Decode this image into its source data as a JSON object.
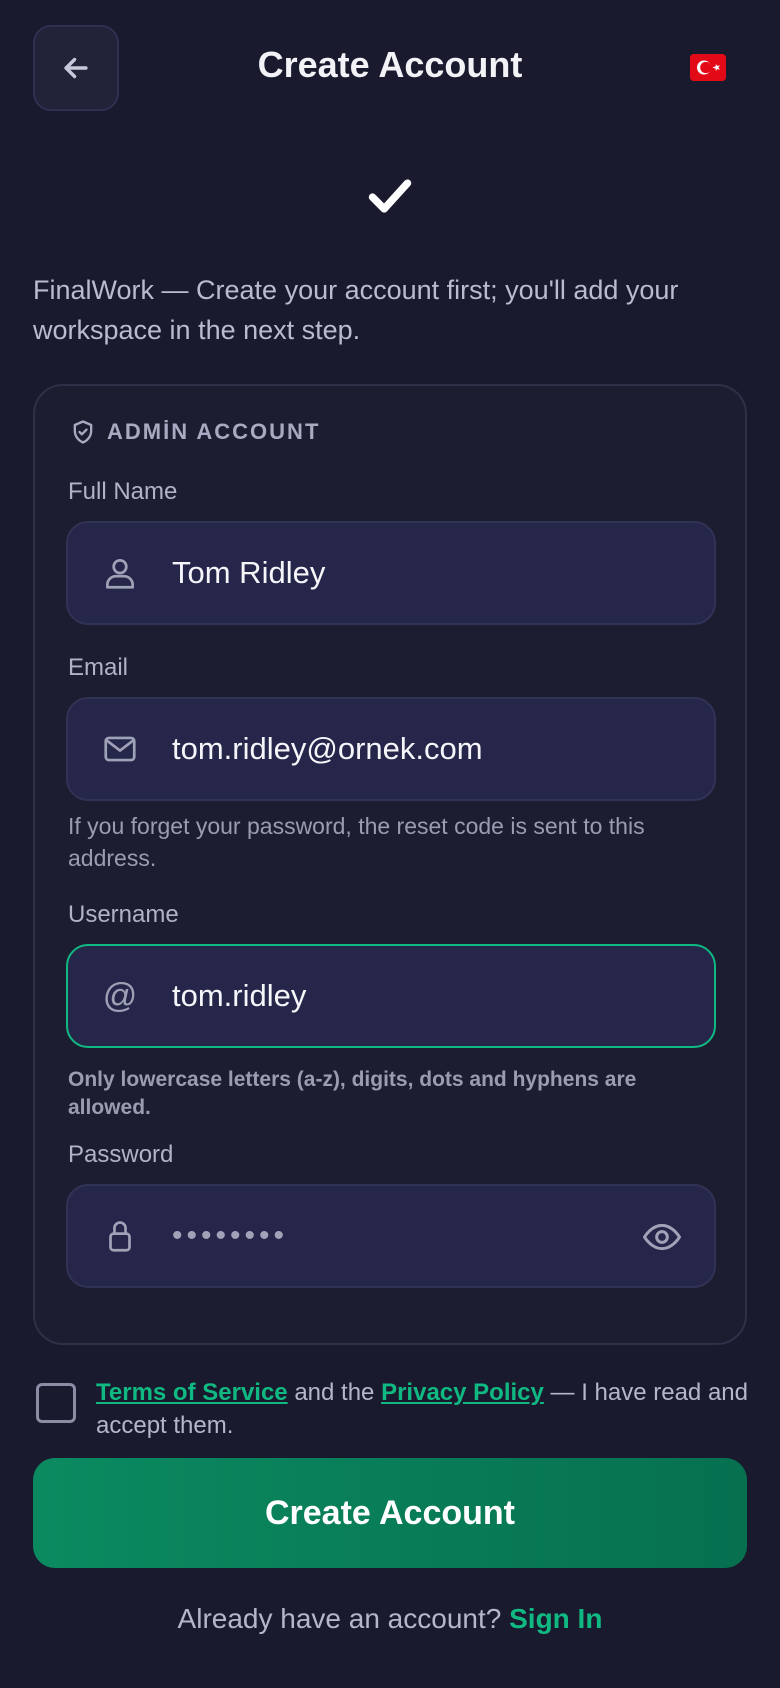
{
  "header": {
    "title": "Create Account",
    "back_icon": "arrow-left-icon",
    "flag_icon": "turkey-flag-icon"
  },
  "intro_text": "FinalWork — Create your account first; you'll add your workspace in the next step.",
  "card": {
    "section_title": "ADMİN ACCOUNT",
    "full_name": {
      "label": "Full Name",
      "value": "Tom Ridley",
      "icon": "user-icon"
    },
    "email": {
      "label": "Email",
      "value": "tom.ridley@ornek.com",
      "icon": "mail-icon",
      "hint": "If you forget your password, the reset code is sent to this address."
    },
    "username": {
      "label": "Username",
      "prefix": "@",
      "value": "tom.ridley",
      "hint": "Only lowercase letters (a-z), digits, dots and hyphens are allowed."
    },
    "password": {
      "label": "Password",
      "masked_value": "••••••••",
      "icon": "lock-icon",
      "toggle_icon": "eye-icon"
    }
  },
  "terms": {
    "checked": false,
    "tos_link": "Terms of Service",
    "middle": " and the ",
    "privacy_link": "Privacy Policy",
    "suffix": " — I have read and accept them."
  },
  "submit_label": "Create Account",
  "signin": {
    "prompt": "Already have an account? ",
    "link": "Sign In"
  },
  "colors": {
    "background": "#191a2e",
    "accent": "#10b981",
    "button_start": "#0b8a60",
    "button_end": "#06704f"
  }
}
